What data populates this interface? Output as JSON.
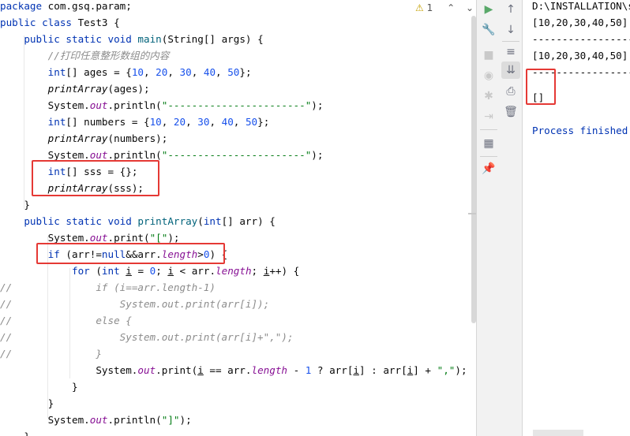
{
  "editor": {
    "inspection_count": "1",
    "lines": [
      {
        "parts": [
          {
            "t": "package",
            "c": "kw"
          },
          {
            "t": " com.gsq.param;"
          }
        ]
      },
      {
        "parts": [
          {
            "t": "public class",
            "c": "kw"
          },
          {
            "t": " Test3 {"
          }
        ]
      },
      {
        "parts": [
          {
            "t": "    "
          },
          {
            "t": "public static void",
            "c": "kw"
          },
          {
            "t": " "
          },
          {
            "t": "main",
            "c": "mth"
          },
          {
            "t": "(String[] args) {"
          }
        ]
      },
      {
        "parts": [
          {
            "t": "        "
          },
          {
            "t": "//打印任意整形数组的内容",
            "c": "cmt"
          }
        ]
      },
      {
        "parts": [
          {
            "t": "        "
          },
          {
            "t": "int",
            "c": "kw"
          },
          {
            "t": "[] ages = {"
          },
          {
            "t": "10",
            "c": "num"
          },
          {
            "t": ", "
          },
          {
            "t": "20",
            "c": "num"
          },
          {
            "t": ", "
          },
          {
            "t": "30",
            "c": "num"
          },
          {
            "t": ", "
          },
          {
            "t": "40",
            "c": "num"
          },
          {
            "t": ", "
          },
          {
            "t": "50",
            "c": "num"
          },
          {
            "t": "};"
          }
        ]
      },
      {
        "parts": [
          {
            "t": "        "
          },
          {
            "t": "printArray",
            "c": "ital"
          },
          {
            "t": "(ages);"
          }
        ]
      },
      {
        "parts": [
          {
            "t": "        System."
          },
          {
            "t": "out",
            "c": "fld"
          },
          {
            "t": ".println("
          },
          {
            "t": "\"-----------------------\"",
            "c": "str"
          },
          {
            "t": ");"
          }
        ]
      },
      {
        "parts": [
          {
            "t": "        "
          },
          {
            "t": "int",
            "c": "kw"
          },
          {
            "t": "[] numbers = {"
          },
          {
            "t": "10",
            "c": "num"
          },
          {
            "t": ", "
          },
          {
            "t": "20",
            "c": "num"
          },
          {
            "t": ", "
          },
          {
            "t": "30",
            "c": "num"
          },
          {
            "t": ", "
          },
          {
            "t": "40",
            "c": "num"
          },
          {
            "t": ", "
          },
          {
            "t": "50",
            "c": "num"
          },
          {
            "t": "};"
          }
        ]
      },
      {
        "parts": [
          {
            "t": "        "
          },
          {
            "t": "printArray",
            "c": "ital"
          },
          {
            "t": "(numbers);"
          }
        ]
      },
      {
        "parts": [
          {
            "t": "        System."
          },
          {
            "t": "out",
            "c": "fld"
          },
          {
            "t": ".println("
          },
          {
            "t": "\"-----------------------\"",
            "c": "str"
          },
          {
            "t": ");"
          }
        ]
      },
      {
        "parts": [
          {
            "t": "        "
          },
          {
            "t": "int",
            "c": "kw"
          },
          {
            "t": "[] sss = {};"
          }
        ]
      },
      {
        "parts": [
          {
            "t": "        "
          },
          {
            "t": "printArray",
            "c": "ital"
          },
          {
            "t": "(sss);"
          }
        ]
      },
      {
        "parts": [
          {
            "t": "    }"
          }
        ]
      },
      {
        "parts": [
          {
            "t": "    "
          },
          {
            "t": "public static void",
            "c": "kw"
          },
          {
            "t": " "
          },
          {
            "t": "printArray",
            "c": "mth"
          },
          {
            "t": "("
          },
          {
            "t": "int",
            "c": "kw"
          },
          {
            "t": "[] arr) {"
          }
        ]
      },
      {
        "parts": [
          {
            "t": "        System."
          },
          {
            "t": "out",
            "c": "fld"
          },
          {
            "t": ".print("
          },
          {
            "t": "\"[\"",
            "c": "str"
          },
          {
            "t": ");"
          }
        ]
      },
      {
        "parts": [
          {
            "t": "        "
          },
          {
            "t": "if",
            "c": "kw"
          },
          {
            "t": " (arr!="
          },
          {
            "t": "null",
            "c": "kw"
          },
          {
            "t": "&&arr."
          },
          {
            "t": "length",
            "c": "fld"
          },
          {
            "t": ">"
          },
          {
            "t": "0",
            "c": "num"
          },
          {
            "t": ") {"
          }
        ]
      },
      {
        "parts": [
          {
            "t": "            "
          },
          {
            "t": "for",
            "c": "kw"
          },
          {
            "t": " ("
          },
          {
            "t": "int",
            "c": "kw"
          },
          {
            "t": " "
          },
          {
            "t": "i",
            "c": "ul"
          },
          {
            "t": " = "
          },
          {
            "t": "0",
            "c": "num"
          },
          {
            "t": "; "
          },
          {
            "t": "i",
            "c": "ul"
          },
          {
            "t": " < arr."
          },
          {
            "t": "length",
            "c": "fld"
          },
          {
            "t": "; "
          },
          {
            "t": "i",
            "c": "ul"
          },
          {
            "t": "++) {"
          }
        ]
      },
      {
        "parts": [
          {
            "t": "//",
            "c": "cmt"
          },
          {
            "t": "              if (i==arr.length-1)",
            "c": "cmt"
          }
        ]
      },
      {
        "parts": [
          {
            "t": "//",
            "c": "cmt"
          },
          {
            "t": "                  System.out.print(arr[i]);",
            "c": "cmt"
          }
        ]
      },
      {
        "parts": [
          {
            "t": "//",
            "c": "cmt"
          },
          {
            "t": "              else {",
            "c": "cmt"
          }
        ]
      },
      {
        "parts": [
          {
            "t": "//",
            "c": "cmt"
          },
          {
            "t": "                  System.out.print(arr[i]+\",\");",
            "c": "cmt"
          }
        ]
      },
      {
        "parts": [
          {
            "t": "//",
            "c": "cmt"
          },
          {
            "t": "              }",
            "c": "cmt"
          }
        ]
      },
      {
        "parts": [
          {
            "t": "                System."
          },
          {
            "t": "out",
            "c": "fld"
          },
          {
            "t": ".print("
          },
          {
            "t": "i",
            "c": "ul"
          },
          {
            "t": " == arr."
          },
          {
            "t": "length",
            "c": "fld"
          },
          {
            "t": " - "
          },
          {
            "t": "1",
            "c": "num"
          },
          {
            "t": " ? arr["
          },
          {
            "t": "i",
            "c": "ul"
          },
          {
            "t": "] : arr["
          },
          {
            "t": "i",
            "c": "ul"
          },
          {
            "t": "] + "
          },
          {
            "t": "\",\"",
            "c": "str"
          },
          {
            "t": ");"
          }
        ]
      },
      {
        "parts": [
          {
            "t": "            }"
          }
        ]
      },
      {
        "parts": [
          {
            "t": "        }"
          }
        ]
      },
      {
        "parts": [
          {
            "t": "        System."
          },
          {
            "t": "out",
            "c": "fld"
          },
          {
            "t": ".println("
          },
          {
            "t": "\"]\"",
            "c": "str"
          },
          {
            "t": ");"
          }
        ]
      },
      {
        "parts": [
          {
            "t": "    }"
          }
        ]
      }
    ]
  },
  "console": {
    "lines": [
      {
        "text": "D:\\INSTALLATION\\so",
        "color": "#080808"
      },
      {
        "text": "[10,20,30,40,50]",
        "color": "#080808"
      },
      {
        "text": "------------------",
        "color": "#080808"
      },
      {
        "text": "[10,20,30,40,50]",
        "color": "#080808"
      },
      {
        "text": "------------------",
        "color": "#080808"
      },
      {
        "text": "[]",
        "color": "#080808"
      },
      {
        "text": "",
        "color": "#080808"
      },
      {
        "text": "Process finished w",
        "color": "#0033b3"
      }
    ]
  },
  "toolbar": {
    "left_icons": [
      "run-icon",
      "wrench-icon",
      "stop-icon",
      "camera-icon",
      "debug-bug-icon",
      "login-icon",
      "layout-icon",
      "pin-icon"
    ],
    "right_icons": [
      "arrow-up-icon",
      "arrow-down-icon",
      "soft-wrap-icon",
      "scroll-to-end-icon",
      "print-icon",
      "trash-icon"
    ]
  },
  "colors": {
    "highlight_box": "#e53935",
    "keyword": "#0033b3",
    "string": "#067d17",
    "number": "#1750eb",
    "comment": "#8c8c8c"
  }
}
